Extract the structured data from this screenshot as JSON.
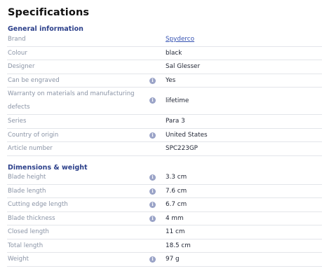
{
  "title": "Specifications",
  "sections": [
    {
      "title": "General information",
      "rows": [
        {
          "label": "Brand",
          "value": "Spyderco",
          "link": true,
          "info": false
        },
        {
          "label": "Colour",
          "value": "black",
          "info": false
        },
        {
          "label": "Designer",
          "value": "Sal Glesser",
          "info": false
        },
        {
          "label": "Can be engraved",
          "value": "Yes",
          "info": true
        },
        {
          "label": "Warranty on materials and manufacturing defects",
          "value": "lifetime",
          "info": true
        },
        {
          "label": "Series",
          "value": "Para 3",
          "info": false
        },
        {
          "label": "Country of origin",
          "value": "United States",
          "info": true
        },
        {
          "label": "Article number",
          "value": "SPC223GP",
          "info": false
        }
      ]
    },
    {
      "title": "Dimensions & weight",
      "rows": [
        {
          "label": "Blade height",
          "value": "3.3 cm",
          "info": true
        },
        {
          "label": "Blade length",
          "value": "7.6 cm",
          "info": true
        },
        {
          "label": "Cutting edge length",
          "value": "6.7 cm",
          "info": true
        },
        {
          "label": "Blade thickness",
          "value": "4 mm",
          "info": true
        },
        {
          "label": "Closed length",
          "value": "11 cm",
          "info": false
        },
        {
          "label": "Total length",
          "value": "18.5 cm",
          "info": false
        },
        {
          "label": "Weight",
          "value": "97 g",
          "info": true
        }
      ]
    }
  ],
  "info_icon_glyph": "i",
  "colors": {
    "section_title": "#2b3f8a",
    "link": "#3451b2",
    "label": "#8a94a6",
    "info_icon": "#9aa3c7"
  }
}
